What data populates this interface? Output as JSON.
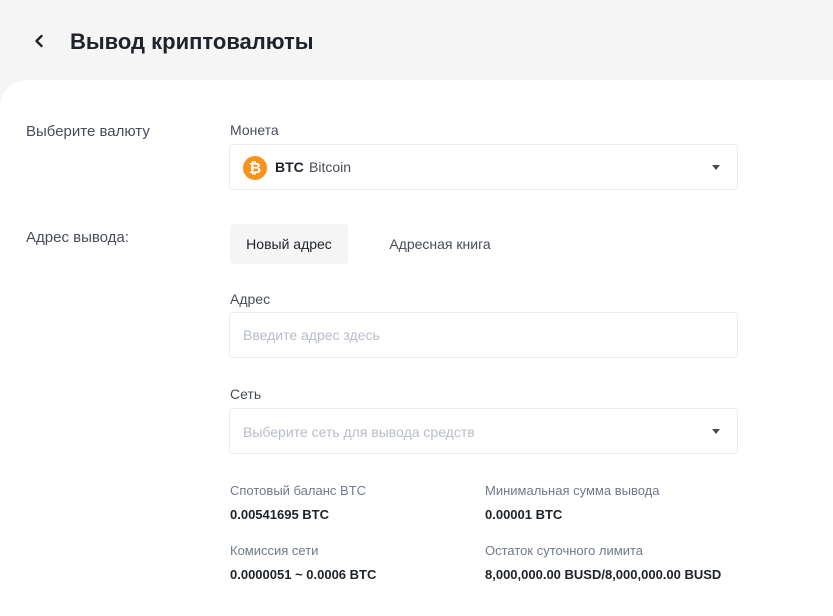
{
  "header": {
    "title": "Вывод криптовалюты",
    "back_icon": "chevron-left-icon"
  },
  "currency_section": {
    "label": "Выберите валюту",
    "coin_label": "Монета",
    "selected_coin": {
      "symbol": "BTC",
      "name": "Bitcoin",
      "icon_glyph": "₿",
      "icon": "bitcoin-icon",
      "icon_color": "#f7931a"
    }
  },
  "address_section": {
    "label": "Адрес вывода:",
    "tabs": [
      {
        "label": "Новый адрес",
        "active": true
      },
      {
        "label": "Адресная книга",
        "active": false
      }
    ],
    "address_label": "Адрес",
    "address_placeholder": "Введите адрес здесь",
    "address_value": "",
    "network_label": "Сеть",
    "network_placeholder": "Выберите сеть для вывода средств"
  },
  "info": {
    "spot_balance_label": "Спотовый баланс BTC",
    "spot_balance_value": "0.00541695 BTC",
    "min_withdraw_label": "Минимальная сумма вывода",
    "min_withdraw_value": "0.00001 BTC",
    "network_fee_label": "Комиссия сети",
    "network_fee_value": "0.0000051 ~ 0.0006 BTC",
    "daily_limit_label": "Остаток суточного лимита",
    "daily_limit_value": "8,000,000.00 BUSD/8,000,000.00 BUSD"
  },
  "colors": {
    "text_primary": "#1e2329",
    "text_secondary": "#474d57",
    "text_muted": "#707a8a",
    "placeholder": "#b7bdc6",
    "border": "#eaecef",
    "page_bg": "#f5f5f5"
  }
}
